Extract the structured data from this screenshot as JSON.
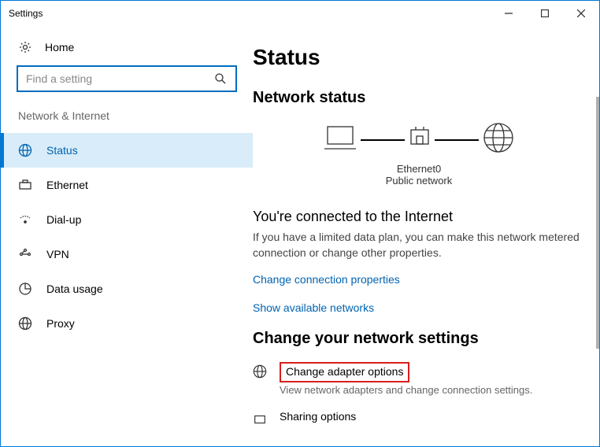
{
  "window": {
    "title": "Settings"
  },
  "sidebar": {
    "home": "Home",
    "search_placeholder": "Find a setting",
    "section": "Network & Internet",
    "items": [
      {
        "label": "Status"
      },
      {
        "label": "Ethernet"
      },
      {
        "label": "Dial-up"
      },
      {
        "label": "VPN"
      },
      {
        "label": "Data usage"
      },
      {
        "label": "Proxy"
      }
    ]
  },
  "main": {
    "title": "Status",
    "network_status": "Network status",
    "adapter_name": "Ethernet0",
    "network_profile": "Public network",
    "connected_title": "You're connected to the Internet",
    "connected_body": "If you have a limited data plan, you can make this network metered connection or change other properties.",
    "link_props": "Change connection properties",
    "link_networks": "Show available networks",
    "change_settings": "Change your network settings",
    "adapter_options": {
      "title": "Change adapter options",
      "desc": "View network adapters and change connection settings."
    },
    "sharing_options": {
      "title": "Sharing options"
    }
  }
}
